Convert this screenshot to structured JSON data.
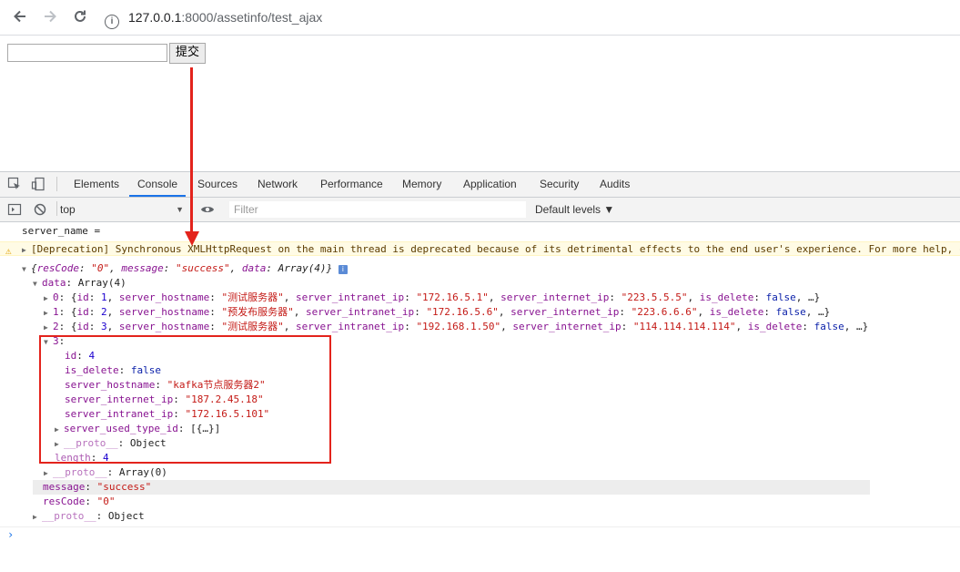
{
  "browser": {
    "url_host": "127.0.0.1",
    "url_path": ":8000/assetinfo/test_ajax",
    "back_icon": "arrow-left-icon",
    "forward_icon": "arrow-right-icon",
    "reload_icon": "reload-icon",
    "info_icon": "info-icon"
  },
  "page": {
    "input_value": "",
    "submit_label": "提交"
  },
  "devtools": {
    "tabs": [
      "Elements",
      "Console",
      "Sources",
      "Network",
      "Performance",
      "Memory",
      "Application",
      "Security",
      "Audits"
    ],
    "active_tab": "Console",
    "context": "top",
    "filter_placeholder": "Filter",
    "levels": "Default levels ▼"
  },
  "console": {
    "log1": "server_name =",
    "warning": "[Deprecation] Synchronous XMLHttpRequest on the main thread is deprecated because of its detrimental effects to the end user's experience. For more help, c",
    "obj_summary": {
      "open": "{",
      "k1": "resCode",
      "v1": "\"0\"",
      "k2": "message",
      "v2": "\"success\"",
      "k3": "data",
      "v3": "Array(4)",
      "close": "}"
    },
    "data_label": "data",
    "data_type": "Array(4)",
    "items": [
      {
        "idx": "0",
        "id": "1",
        "hostname": "\"测试服务器\"",
        "intranet": "\"172.16.5.1\"",
        "internet": "\"223.5.5.5\"",
        "is_delete": "false"
      },
      {
        "idx": "1",
        "id": "2",
        "hostname": "\"预发布服务器\"",
        "intranet": "\"172.16.5.6\"",
        "internet": "\"223.6.6.6\"",
        "is_delete": "false"
      },
      {
        "idx": "2",
        "id": "3",
        "hostname": "\"测试服务器\"",
        "intranet": "\"192.168.1.50\"",
        "internet": "\"114.114.114.114\"",
        "is_delete": "false"
      }
    ],
    "expanded": {
      "idx": "3",
      "id": "4",
      "is_delete": "false",
      "server_hostname": "\"kafka节点服务器2\"",
      "server_internet_ip": "\"187.2.45.18\"",
      "server_intranet_ip": "\"172.16.5.101\"",
      "server_used_type_id": "[{…}]",
      "proto": "Object"
    },
    "length": "4",
    "array_proto": "Array(0)",
    "message": "\"success\"",
    "resCode": "\"0\"",
    "root_proto": "Object"
  },
  "colors": {
    "annotation": "#e3231c",
    "key": "#881391",
    "string": "#c41a16",
    "number": "#1c00cf"
  }
}
